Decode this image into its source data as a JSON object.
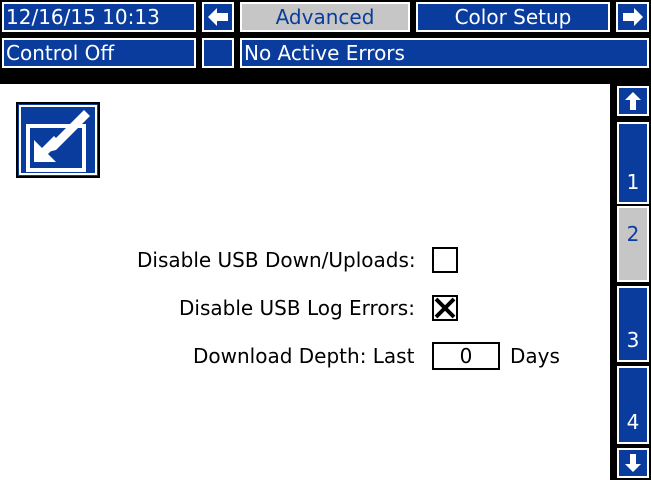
{
  "header": {
    "datetime": "12/16/15 10:13",
    "tab_left_icon": "left-arrow-icon",
    "tab_current": "Advanced",
    "tab_next": "Color Setup",
    "tab_right_icon": "right-arrow-icon"
  },
  "status": {
    "control": "Control Off",
    "errors": "No Active Errors"
  },
  "edit_icon": "edit-icon",
  "settings": {
    "usb_updown_label": "Disable USB Down/Uploads:",
    "usb_updown_checked": false,
    "usb_log_label": "Disable USB Log Errors:",
    "usb_log_checked": true,
    "depth_label": "Download Depth: Last",
    "depth_value": "0",
    "depth_unit": "Days"
  },
  "side_nav": {
    "up_icon": "up-arrow-icon",
    "pages": [
      "1",
      "2",
      "3",
      "4"
    ],
    "selected": "2",
    "down_icon": "down-arrow-icon"
  },
  "colors": {
    "accent": "#0a3c9e",
    "selected_bg": "#c6c6c6",
    "background": "#000000"
  }
}
